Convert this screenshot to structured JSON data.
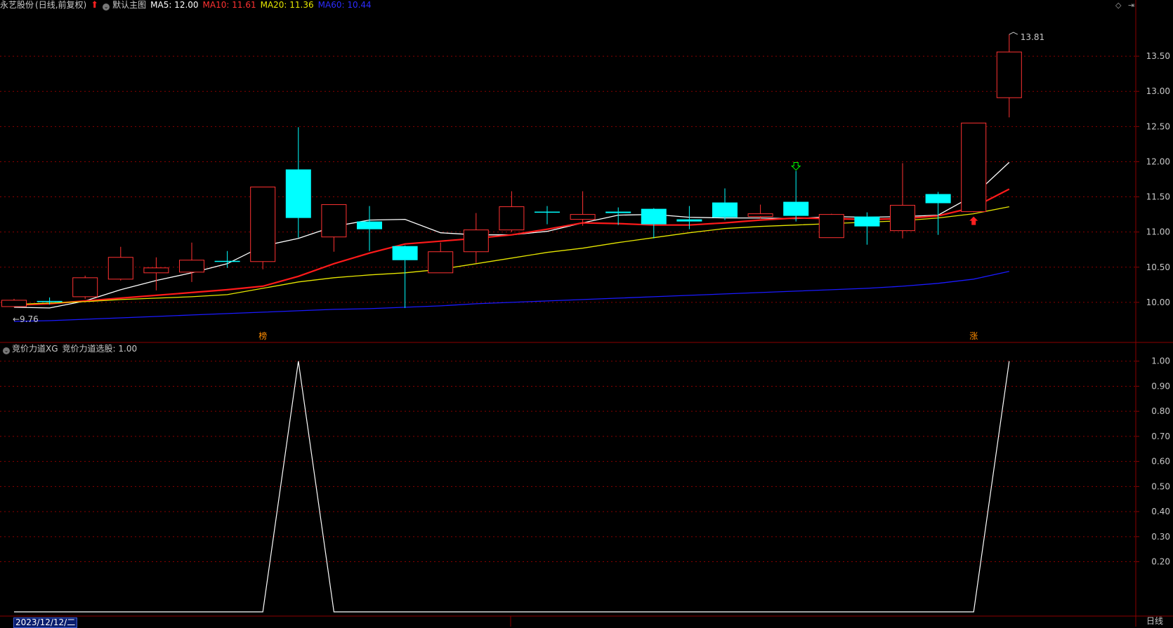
{
  "header": {
    "stock_name": "永艺股份",
    "mode": "(日线,前复权)",
    "template": "默认主图",
    "ma5_label": "MA5: 12.00",
    "ma10_label": "MA10: 11.61",
    "ma20_label": "MA20: 11.36",
    "ma60_label": "MA60: 10.44",
    "icons": [
      "red-up-arrow-icon",
      "dropdown-circle-icon",
      "diamond-icon",
      "expand-icon"
    ]
  },
  "sub_header": {
    "indicator": "竞价力道XG",
    "value_label": "竞价力道选股: 1.00"
  },
  "footer": {
    "date": "2023/12/12/二",
    "period": "日线"
  },
  "colors": {
    "up": "#ff3232",
    "down": "#00ffff",
    "ma5": "#ffffff",
    "ma10": "#ff1a1a",
    "ma20": "#e6e600",
    "ma60": "#1a1aff",
    "grid": "#8b0000",
    "axis_text": "#c8c8c8"
  },
  "chart_data": [
    {
      "type": "candlestick",
      "ylim": [
        9.6,
        13.9
      ],
      "yticks": [
        10.0,
        10.5,
        11.0,
        11.5,
        12.0,
        12.5,
        13.0,
        13.5
      ],
      "high_label": "13.81",
      "low_label": "9.76",
      "markers": [
        {
          "index": 7,
          "text": "榜"
        },
        {
          "index": 27,
          "text": "涨"
        }
      ],
      "signals": [
        {
          "index": 22,
          "kind": "sell-arrow"
        },
        {
          "index": 27,
          "kind": "buy-arrow"
        }
      ],
      "candles": [
        {
          "o": 9.94,
          "h": 10.05,
          "l": 9.93,
          "c": 10.03
        },
        {
          "o": 10.02,
          "h": 10.07,
          "l": 9.97,
          "c": 10.01
        },
        {
          "o": 10.08,
          "h": 10.38,
          "l": 10.05,
          "c": 10.35
        },
        {
          "o": 10.33,
          "h": 10.79,
          "l": 10.31,
          "c": 10.64
        },
        {
          "o": 10.42,
          "h": 10.64,
          "l": 10.17,
          "c": 10.49
        },
        {
          "o": 10.43,
          "h": 10.85,
          "l": 10.29,
          "c": 10.6
        },
        {
          "o": 10.59,
          "h": 10.73,
          "l": 10.49,
          "c": 10.58
        },
        {
          "o": 10.58,
          "h": 11.64,
          "l": 10.47,
          "c": 11.64
        },
        {
          "o": 11.89,
          "h": 12.49,
          "l": 10.92,
          "c": 11.2
        },
        {
          "o": 10.93,
          "h": 11.39,
          "l": 10.72,
          "c": 11.39
        },
        {
          "o": 11.15,
          "h": 11.37,
          "l": 10.73,
          "c": 11.04
        },
        {
          "o": 10.8,
          "h": 10.81,
          "l": 9.92,
          "c": 10.6
        },
        {
          "o": 10.42,
          "h": 10.85,
          "l": 10.42,
          "c": 10.72
        },
        {
          "o": 10.72,
          "h": 11.27,
          "l": 10.56,
          "c": 11.03
        },
        {
          "o": 11.03,
          "h": 11.58,
          "l": 11.0,
          "c": 11.36
        },
        {
          "o": 11.29,
          "h": 11.37,
          "l": 11.11,
          "c": 11.28
        },
        {
          "o": 11.18,
          "h": 11.58,
          "l": 11.09,
          "c": 11.25
        },
        {
          "o": 11.29,
          "h": 11.35,
          "l": 11.1,
          "c": 11.27
        },
        {
          "o": 11.33,
          "h": 11.34,
          "l": 10.91,
          "c": 11.11
        },
        {
          "o": 11.18,
          "h": 11.37,
          "l": 11.04,
          "c": 11.15
        },
        {
          "o": 11.42,
          "h": 11.62,
          "l": 11.17,
          "c": 11.21
        },
        {
          "o": 11.22,
          "h": 11.39,
          "l": 11.19,
          "c": 11.26
        },
        {
          "o": 11.43,
          "h": 11.87,
          "l": 11.15,
          "c": 11.23
        },
        {
          "o": 10.92,
          "h": 11.26,
          "l": 10.92,
          "c": 11.25
        },
        {
          "o": 11.22,
          "h": 11.28,
          "l": 10.82,
          "c": 11.08
        },
        {
          "o": 11.02,
          "h": 11.98,
          "l": 10.91,
          "c": 11.38
        },
        {
          "o": 11.54,
          "h": 11.57,
          "l": 10.96,
          "c": 11.41
        },
        {
          "o": 11.29,
          "h": 12.55,
          "l": 11.28,
          "c": 12.55
        },
        {
          "o": 12.91,
          "h": 13.81,
          "l": 12.63,
          "c": 13.56
        }
      ],
      "series": [
        {
          "name": "MA5",
          "values": [
            9.93,
            9.92,
            10.02,
            10.18,
            10.31,
            10.42,
            10.55,
            10.8,
            10.91,
            11.08,
            11.17,
            11.18,
            10.99,
            10.96,
            10.96,
            11.01,
            11.13,
            11.24,
            11.25,
            11.21,
            11.2,
            11.2,
            11.19,
            11.22,
            11.21,
            11.22,
            11.24,
            11.52,
            11.99
          ]
        },
        {
          "name": "MA10",
          "values": [
            9.96,
            9.98,
            10.02,
            10.06,
            10.1,
            10.14,
            10.18,
            10.23,
            10.37,
            10.55,
            10.7,
            10.83,
            10.87,
            10.91,
            10.96,
            11.04,
            11.13,
            11.12,
            11.1,
            11.1,
            11.13,
            11.17,
            11.2,
            11.19,
            11.18,
            11.19,
            11.23,
            11.35,
            11.61
          ]
        },
        {
          "name": "MA20",
          "values": [
            9.97,
            9.99,
            10.01,
            10.04,
            10.06,
            10.08,
            10.11,
            10.2,
            10.29,
            10.35,
            10.39,
            10.42,
            10.47,
            10.55,
            10.63,
            10.71,
            10.77,
            10.85,
            10.92,
            10.99,
            11.05,
            11.08,
            11.1,
            11.12,
            11.14,
            11.16,
            11.2,
            11.26,
            11.36
          ]
        },
        {
          "name": "MA60",
          "values": [
            9.73,
            9.74,
            9.76,
            9.78,
            9.8,
            9.82,
            9.84,
            9.86,
            9.88,
            9.9,
            9.91,
            9.93,
            9.95,
            9.98,
            10.0,
            10.02,
            10.04,
            10.06,
            10.08,
            10.1,
            10.12,
            10.14,
            10.16,
            10.18,
            10.2,
            10.23,
            10.27,
            10.33,
            10.44
          ]
        }
      ]
    },
    {
      "type": "line",
      "name": "竞价力道选股",
      "ylim": [
        0,
        1.03
      ],
      "yticks": [
        0.2,
        0.3,
        0.4,
        0.5,
        0.6,
        0.7,
        0.8,
        0.9,
        1.0
      ],
      "values": [
        0,
        0,
        0,
        0,
        0,
        0,
        0,
        0,
        1,
        0,
        0,
        0,
        0,
        0,
        0,
        0,
        0,
        0,
        0,
        0,
        0,
        0,
        0,
        0,
        0,
        0,
        0,
        0,
        1
      ]
    }
  ]
}
